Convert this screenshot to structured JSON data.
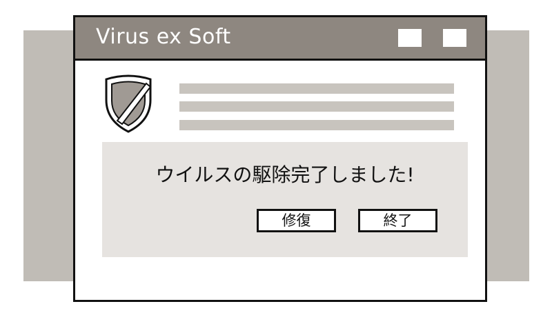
{
  "window": {
    "title": "Virus ex Soft"
  },
  "dialog": {
    "message": "ウイルスの駆除完了しました!",
    "repair_label": "修復",
    "quit_label": "終了"
  },
  "icons": {
    "app_icon": "shield-icon"
  },
  "colors": {
    "titlebar": "#8e8780",
    "backdrop": "#c0bcb6",
    "panel": "#e6e3e0",
    "placeholder_lines": "#c8c4be"
  }
}
